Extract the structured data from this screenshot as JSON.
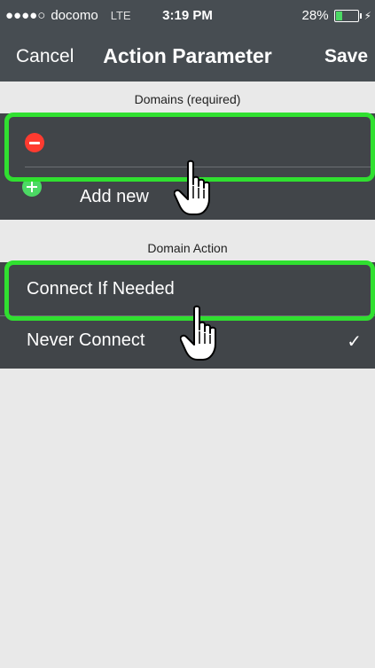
{
  "status_bar": {
    "signal": "●●●●○",
    "carrier": "docomo",
    "network": "LTE",
    "time": "3:19 PM",
    "battery": "28%",
    "battery_level": 0.28
  },
  "nav": {
    "cancel_label": "Cancel",
    "title": "Action Parameter",
    "save_label": "Save"
  },
  "domains_section": {
    "header": "Domains (required)",
    "domain_value": "",
    "add_label": "Add new"
  },
  "action_section": {
    "header": "Domain Action",
    "options": [
      {
        "label": "Connect If Needed",
        "selected": false
      },
      {
        "label": "Never Connect",
        "selected": true
      }
    ],
    "check": "✓"
  },
  "colors": {
    "bar": "#474d52",
    "row": "#414549",
    "background": "#e9e9e9",
    "highlight": "#30e030",
    "delete": "#ff3b30",
    "add": "#4cd964"
  }
}
